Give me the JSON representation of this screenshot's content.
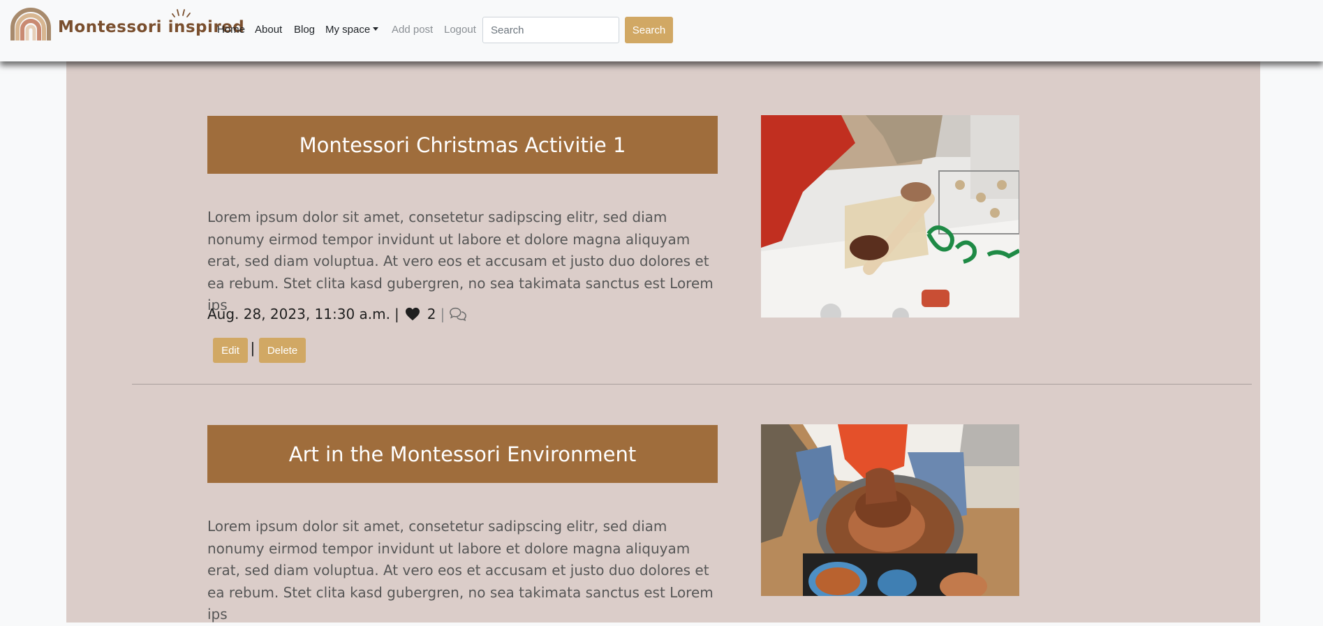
{
  "brand": {
    "name": "Montessori inspired"
  },
  "nav": {
    "home": "Home",
    "about": "About",
    "blog": "Blog",
    "my_space": "My space",
    "add_post": "Add post",
    "logout": "Logout"
  },
  "search": {
    "placeholder": "Search",
    "button": "Search"
  },
  "colors": {
    "accent": "#d1a864",
    "title_bg": "#9f6d3c",
    "content_bg": "#dbcdc9",
    "logo_text": "#7a4f2e"
  },
  "posts": [
    {
      "title": "Montessori Christmas Activitie 1",
      "excerpt": "Lorem ipsum dolor sit amet, consetetur sadipscing elitr, sed diam nonumy eirmod tempor invidunt ut labore et dolore magna aliquyam erat, sed diam voluptua. At vero eos et accusam et justo duo dolores et ea rebum. Stet clita kasd gubergren, no sea takimata sanctus est Lorem ips",
      "date": "Aug. 28, 2023, 11:30 a.m.",
      "likes": "2",
      "actions": {
        "edit": "Edit",
        "delete": "Delete"
      },
      "icons": [
        "heart-icon",
        "comment-icon"
      ]
    },
    {
      "title": "Art in the Montessori Environment",
      "excerpt": "Lorem ipsum dolor sit amet, consetetur sadipscing elitr, sed diam nonumy eirmod tempor invidunt ut labore et dolore magna aliquyam erat, sed diam voluptua. At vero eos et accusam et justo duo dolores et ea rebum. Stet clita kasd gubergren, no sea takimata sanctus est Lorem ips"
    }
  ]
}
